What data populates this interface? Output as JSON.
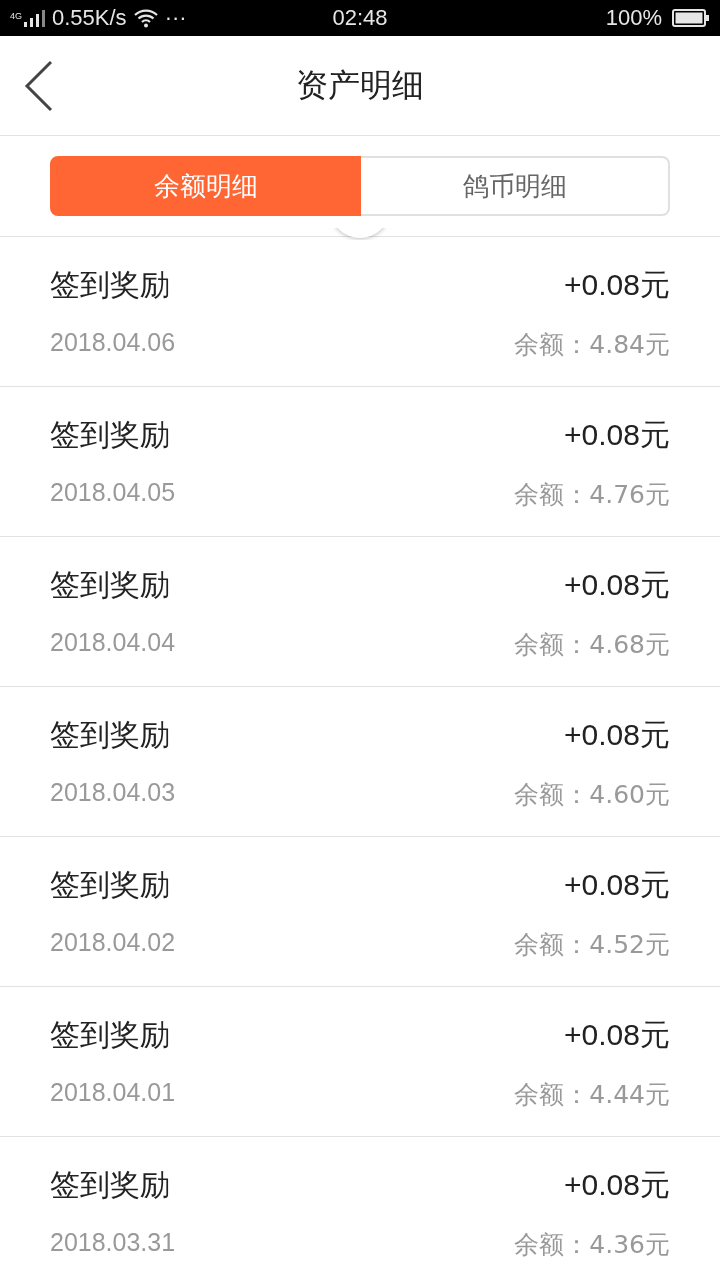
{
  "status_bar": {
    "network": "4G",
    "speed": "0.55K/s",
    "more": "···",
    "time": "02:48",
    "battery": "100%"
  },
  "header": {
    "title": "资产明细"
  },
  "tabs": [
    {
      "label": "余额明细",
      "selected": true
    },
    {
      "label": "鸽币明细",
      "selected": false
    }
  ],
  "records": [
    {
      "title": "签到奖励",
      "amount": "+0.08元",
      "date": "2018.04.06",
      "balance": "余额：4.84元"
    },
    {
      "title": "签到奖励",
      "amount": "+0.08元",
      "date": "2018.04.05",
      "balance": "余额：4.76元"
    },
    {
      "title": "签到奖励",
      "amount": "+0.08元",
      "date": "2018.04.04",
      "balance": "余额：4.68元"
    },
    {
      "title": "签到奖励",
      "amount": "+0.08元",
      "date": "2018.04.03",
      "balance": "余额：4.60元"
    },
    {
      "title": "签到奖励",
      "amount": "+0.08元",
      "date": "2018.04.02",
      "balance": "余额：4.52元"
    },
    {
      "title": "签到奖励",
      "amount": "+0.08元",
      "date": "2018.04.01",
      "balance": "余额：4.44元"
    },
    {
      "title": "签到奖励",
      "amount": "+0.08元",
      "date": "2018.03.31",
      "balance": "余额：4.36元"
    }
  ]
}
